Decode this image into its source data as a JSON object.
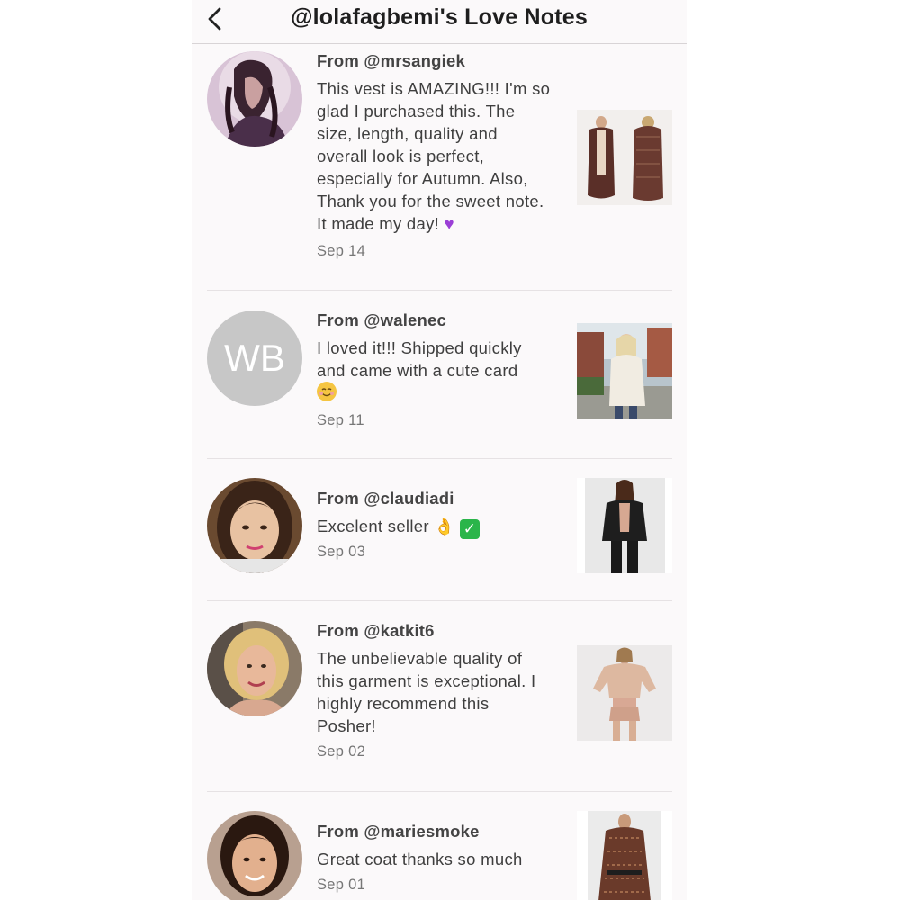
{
  "header": {
    "title": "@lolafagbemi's Love Notes"
  },
  "notes": [
    {
      "from": "From @mrsangiek",
      "message": "This vest is AMAZING!!! I'm so glad I purchased this. The size, length, quality and overall look is perfect, especially for Autumn. Also, Thank you for the sweet note. It made my day!",
      "emoji": "purple-heart",
      "date": "Sep 14"
    },
    {
      "from": "From @walenec",
      "message": "I loved it!!! Shipped quickly and came with a cute card",
      "emoji": "smiling-face",
      "date": "Sep 11",
      "avatar_initials": "WB"
    },
    {
      "from": "From @claudiadi",
      "message": "Excelent seller",
      "emoji": "ok-hand check-mark",
      "date": "Sep 03"
    },
    {
      "from": "From @katkit6",
      "message": "The unbelievable quality of this garment is exceptional. I highly recommend this Posher!",
      "date": "Sep 02"
    },
    {
      "from": "From @mariesmoke",
      "message": "Great coat thanks so much",
      "date": "Sep 01"
    }
  ],
  "colors": {
    "background": "#fbf9fa",
    "text": "#3f3f3f",
    "date": "#777777",
    "divider": "#e6e2e4",
    "heart": "#9b3fd6",
    "check": "#2bb54a"
  }
}
